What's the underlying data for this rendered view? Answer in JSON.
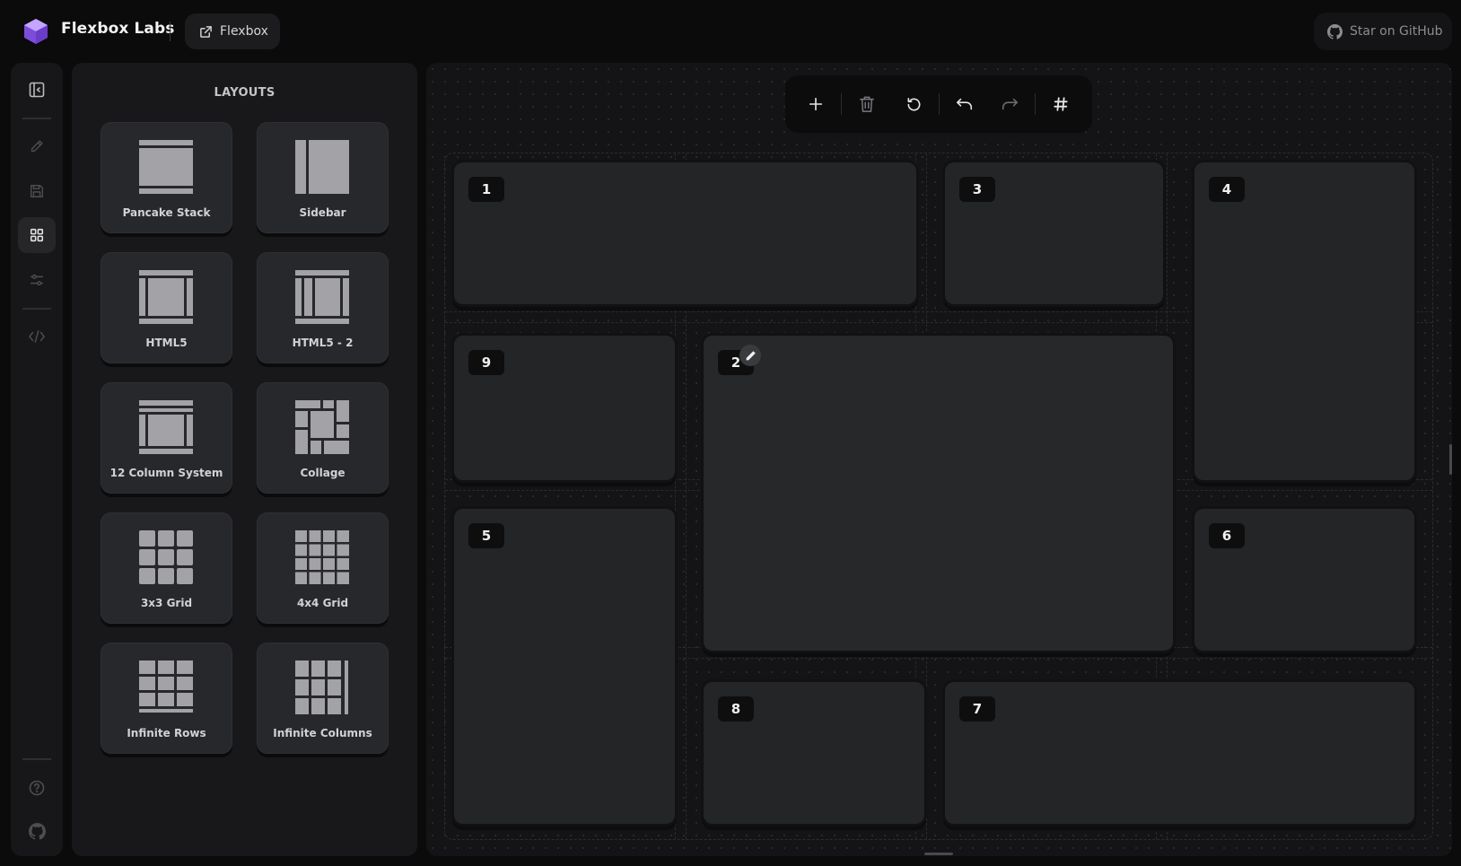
{
  "header": {
    "brand": "Flexbox Labs",
    "link_label": "Flexbox",
    "github_label": "Star on GitHub",
    "accent": "#8b5cf6"
  },
  "rail": {
    "items": [
      {
        "name": "collapse-panel-icon"
      },
      {
        "name": "pencil-icon"
      },
      {
        "name": "save-icon"
      },
      {
        "name": "layouts-grid-icon",
        "active": true
      },
      {
        "name": "sliders-icon"
      },
      {
        "name": "code-icon"
      },
      {
        "name": "help-icon"
      },
      {
        "name": "github-icon"
      }
    ]
  },
  "panel": {
    "title": "LAYOUTS",
    "layouts": [
      {
        "label": "Pancake Stack"
      },
      {
        "label": "Sidebar"
      },
      {
        "label": "HTML5"
      },
      {
        "label": "HTML5 - 2"
      },
      {
        "label": "12 Column System"
      },
      {
        "label": "Collage"
      },
      {
        "label": "3x3 Grid"
      },
      {
        "label": "4x4 Grid"
      },
      {
        "label": "Infinite Rows"
      },
      {
        "label": "Infinite Columns"
      }
    ]
  },
  "toolbar": {
    "buttons": [
      "plus-icon",
      "trash-icon",
      "reset-icon",
      "undo-icon",
      "redo-icon",
      "grid-hash-icon"
    ]
  },
  "canvas": {
    "cells": [
      {
        "label": "1"
      },
      {
        "label": "3"
      },
      {
        "label": "4"
      },
      {
        "label": "9"
      },
      {
        "label": "2",
        "selected": true
      },
      {
        "label": "5"
      },
      {
        "label": "6"
      },
      {
        "label": "8"
      },
      {
        "label": "7"
      }
    ]
  }
}
